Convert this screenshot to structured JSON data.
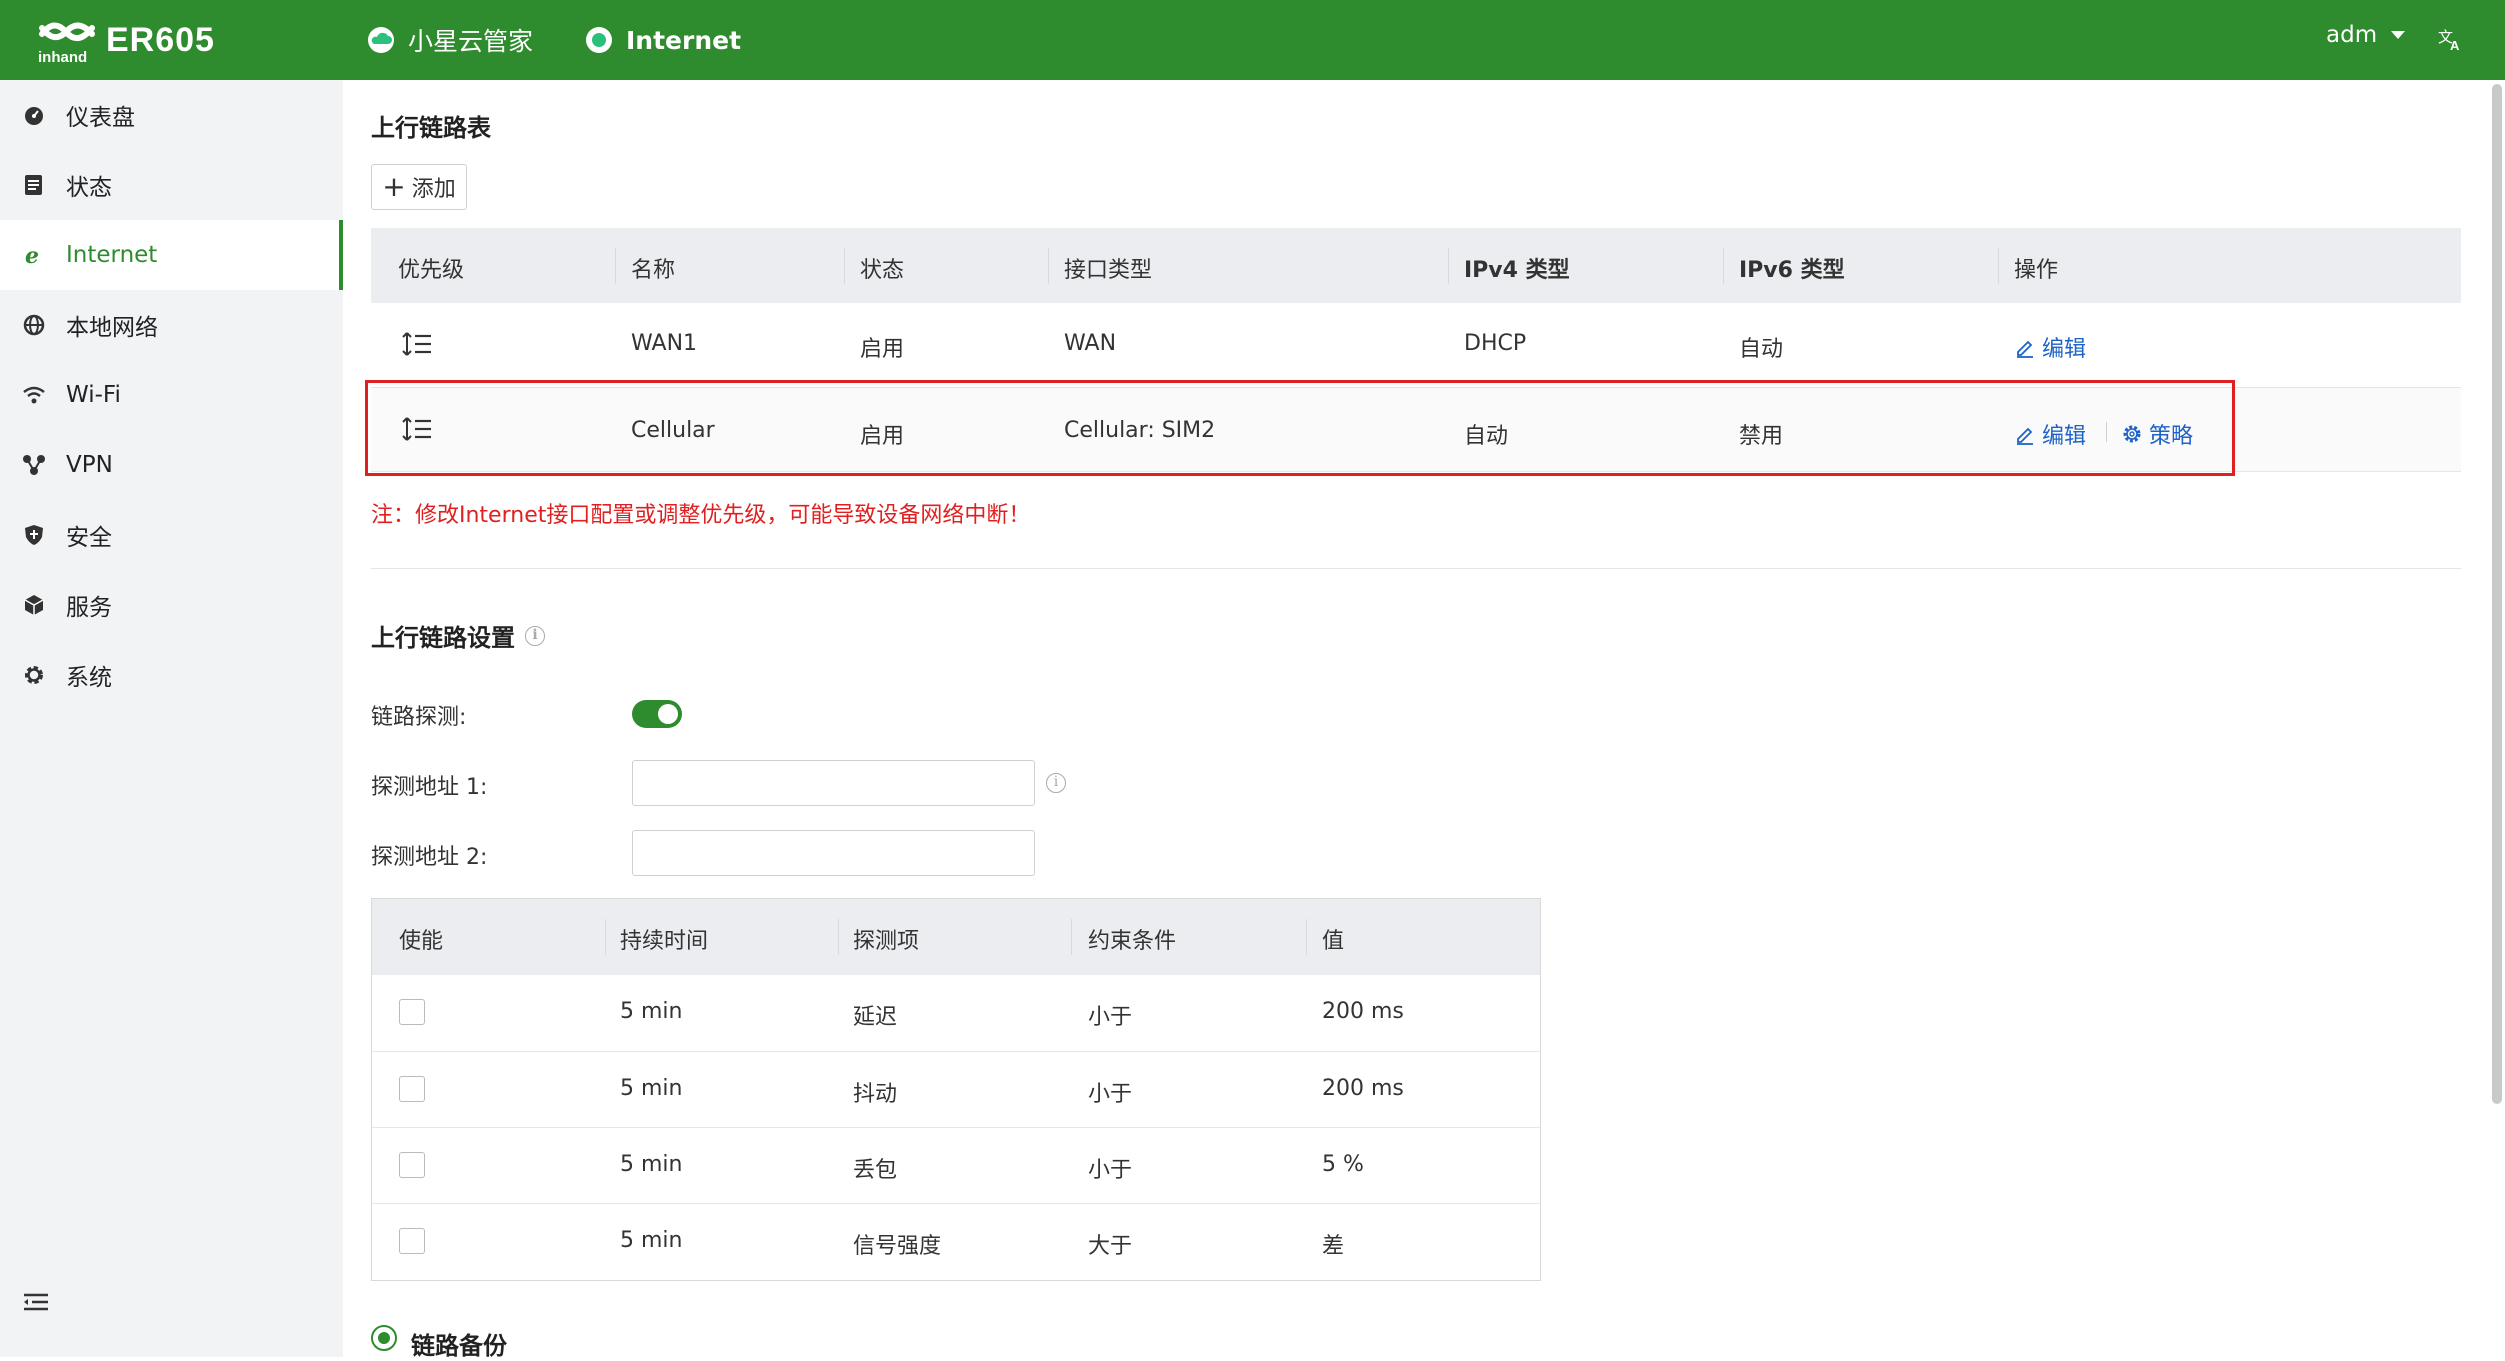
{
  "header": {
    "product": "ER605",
    "cloud_label": "小星云管家",
    "internet_label": "Internet",
    "user": "adm",
    "lang_icon": "translate-icon"
  },
  "sidebar": {
    "items": [
      {
        "label": "仪表盘",
        "icon": "dashboard-icon"
      },
      {
        "label": "状态",
        "icon": "status-icon"
      },
      {
        "label": "Internet",
        "icon": "internet-icon",
        "active": true
      },
      {
        "label": "本地网络",
        "icon": "globe-icon"
      },
      {
        "label": "Wi-Fi",
        "icon": "wifi-icon"
      },
      {
        "label": "VPN",
        "icon": "vpn-icon"
      },
      {
        "label": "安全",
        "icon": "shield-icon"
      },
      {
        "label": "服务",
        "icon": "cube-icon"
      },
      {
        "label": "系统",
        "icon": "gear-icon"
      }
    ]
  },
  "uplink_table": {
    "title": "上行链路表",
    "add_label": "添加",
    "columns": [
      "优先级",
      "名称",
      "状态",
      "接口类型",
      "IPv4 类型",
      "IPv6 类型",
      "操作"
    ],
    "rows": [
      {
        "name": "WAN1",
        "status": "启用",
        "iface": "WAN",
        "ipv4": "DHCP",
        "ipv6": "自动",
        "edit": "编辑"
      },
      {
        "name": "Cellular",
        "status": "启用",
        "iface": "Cellular: SIM2",
        "ipv4": "自动",
        "ipv6": "禁用",
        "edit": "编辑",
        "policy": "策略"
      }
    ],
    "note": "注：修改Internet接口配置或调整优先级，可能导致设备网络中断！"
  },
  "uplink_settings": {
    "title": "上行链路设置",
    "link_detect_label": "链路探测:",
    "link_detect_on": true,
    "addr1_label": "探测地址 1:",
    "addr1_value": "",
    "addr2_label": "探测地址 2:",
    "addr2_value": ""
  },
  "probe_table": {
    "columns": [
      "使能",
      "持续时间",
      "探测项",
      "约束条件",
      "值"
    ],
    "rows": [
      {
        "duration": "5 min",
        "item": "延迟",
        "cond": "小于",
        "value": "200 ms"
      },
      {
        "duration": "5 min",
        "item": "抖动",
        "cond": "小于",
        "value": "200 ms"
      },
      {
        "duration": "5 min",
        "item": "丢包",
        "cond": "小于",
        "value": "5 %"
      },
      {
        "duration": "5 min",
        "item": "信号强度",
        "cond": "大于",
        "value": "差"
      }
    ]
  },
  "backup": {
    "label": "链路备份"
  },
  "colors": {
    "brand": "#2e8b2e",
    "link": "#1e63c8",
    "alert": "#e02020"
  }
}
